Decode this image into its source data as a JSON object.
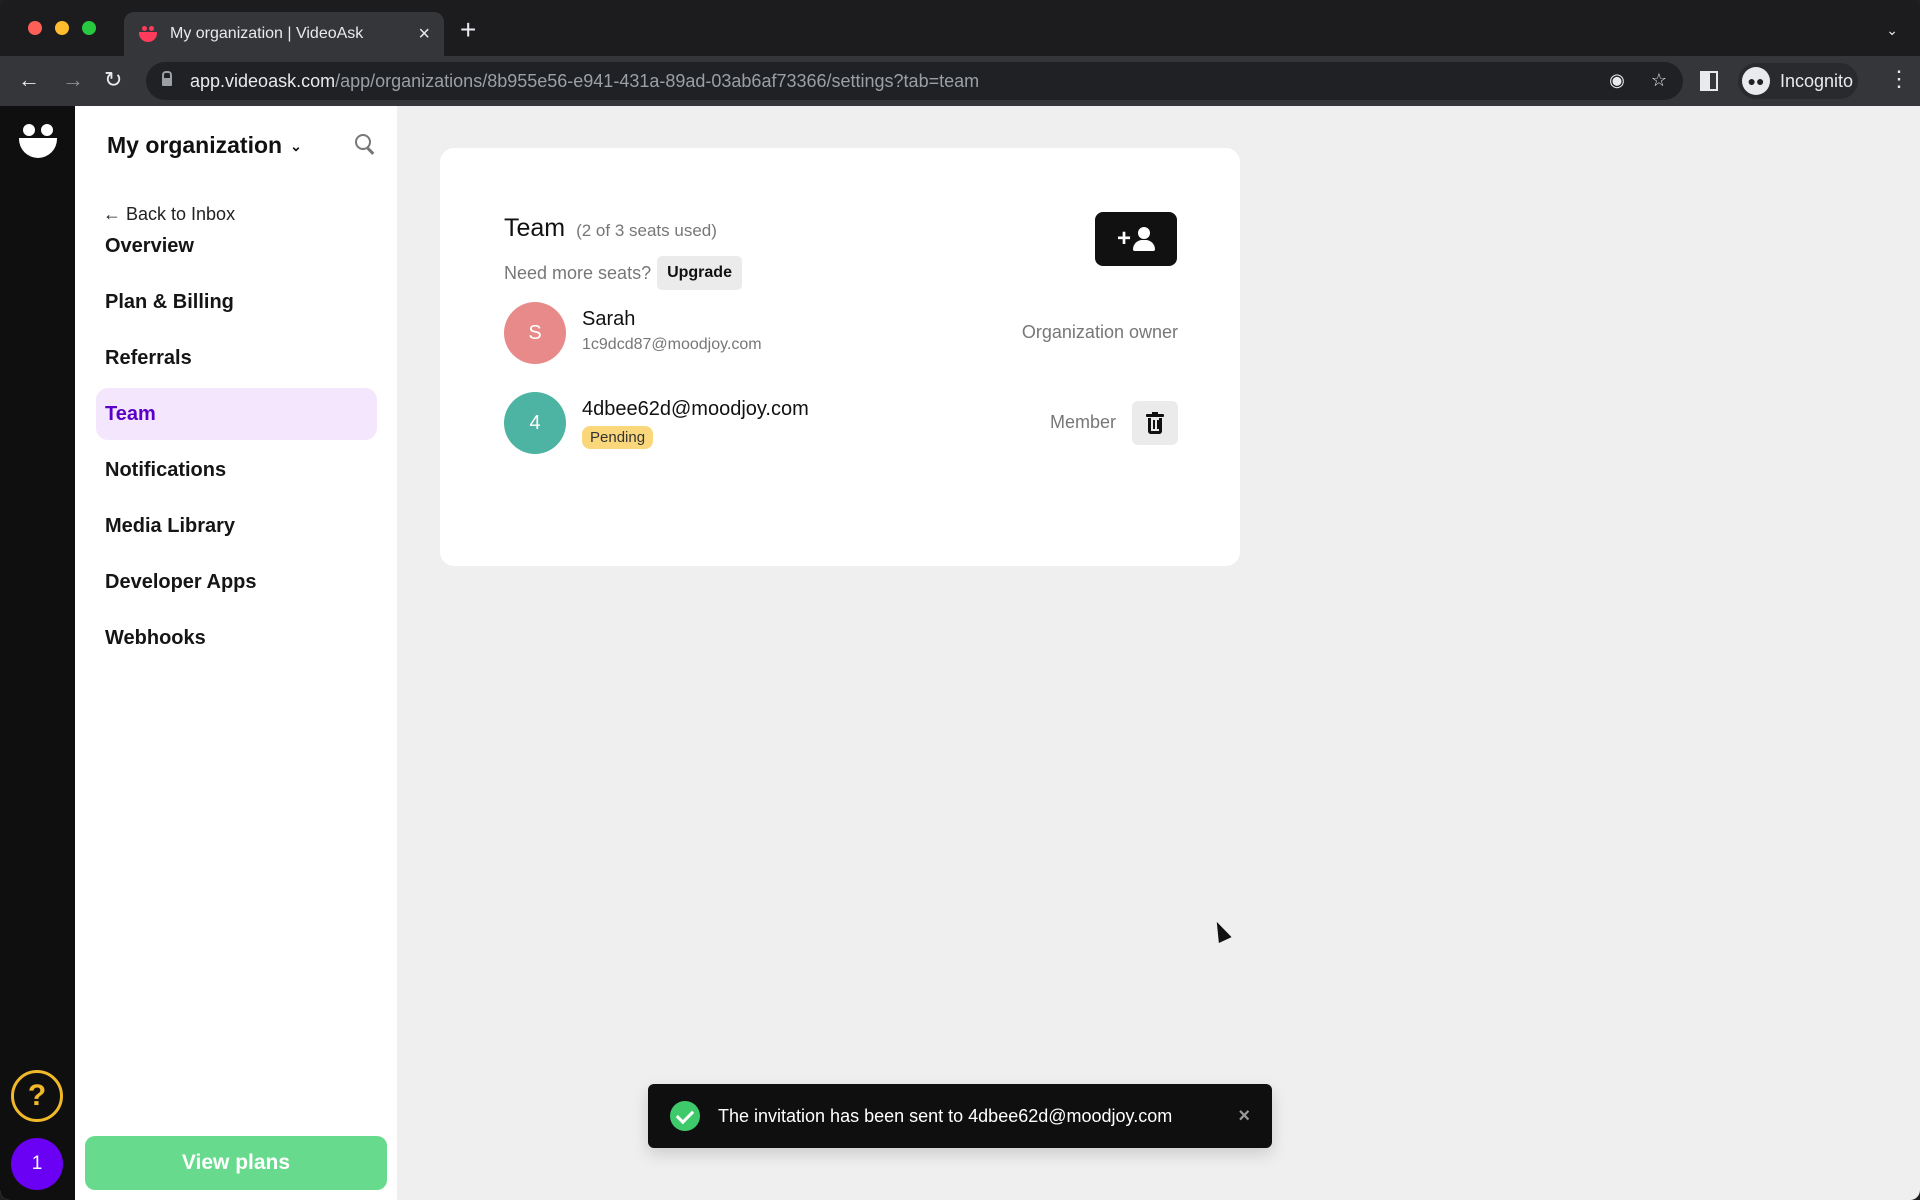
{
  "browser": {
    "tab_title": "My organization | VideoAsk",
    "url_host": "app.videoask.com",
    "url_path": "/app/organizations/8b955e56-e941-431a-89ad-03ab6af73366/settings?tab=team",
    "profile_label": "Incognito",
    "icons": [
      "back-arrow-icon",
      "forward-arrow-icon",
      "reload-icon",
      "lock-icon",
      "eye-off-icon",
      "star-icon",
      "side-panel-icon",
      "incognito-icon",
      "more-vert-icon"
    ]
  },
  "rail": {
    "help_label": "?",
    "notification_count": "1"
  },
  "sidebar": {
    "org_name": "My organization",
    "back_label": "← Back to Inbox",
    "items": [
      {
        "label": "Overview",
        "active": false
      },
      {
        "label": "Plan & Billing",
        "active": false
      },
      {
        "label": "Referrals",
        "active": false
      },
      {
        "label": "Team",
        "active": true
      },
      {
        "label": "Notifications",
        "active": false
      },
      {
        "label": "Media Library",
        "active": false
      },
      {
        "label": "Developer Apps",
        "active": false
      },
      {
        "label": "Webhooks",
        "active": false
      }
    ],
    "view_plans_label": "View plans"
  },
  "team": {
    "title": "Team",
    "seats": "(2 of 3 seats used)",
    "need_more": "Need more seats?",
    "upgrade_label": "Upgrade",
    "add_member_plus": "+",
    "members": [
      {
        "initial": "S",
        "name": "Sarah",
        "email": "1c9dcd87@moodjoy.com",
        "role": "Organization owner",
        "avatar_color": "#e88a8a",
        "pending": null
      },
      {
        "initial": "4",
        "name": "4dbee62d@moodjoy.com",
        "email": null,
        "role": "Member",
        "avatar_color": "#4db3a2",
        "pending": "Pending"
      }
    ]
  },
  "toast": {
    "message": "The invitation has been sent to 4dbee62d@moodjoy.com",
    "close": "×"
  },
  "colors": {
    "accent_purple": "#5a00c7",
    "active_bg": "#f3e6fd",
    "view_plans_green": "#68da8d",
    "success_green": "#3ec96b",
    "pending_yellow": "#f9d77a",
    "help_yellow": "#f1b92a"
  }
}
